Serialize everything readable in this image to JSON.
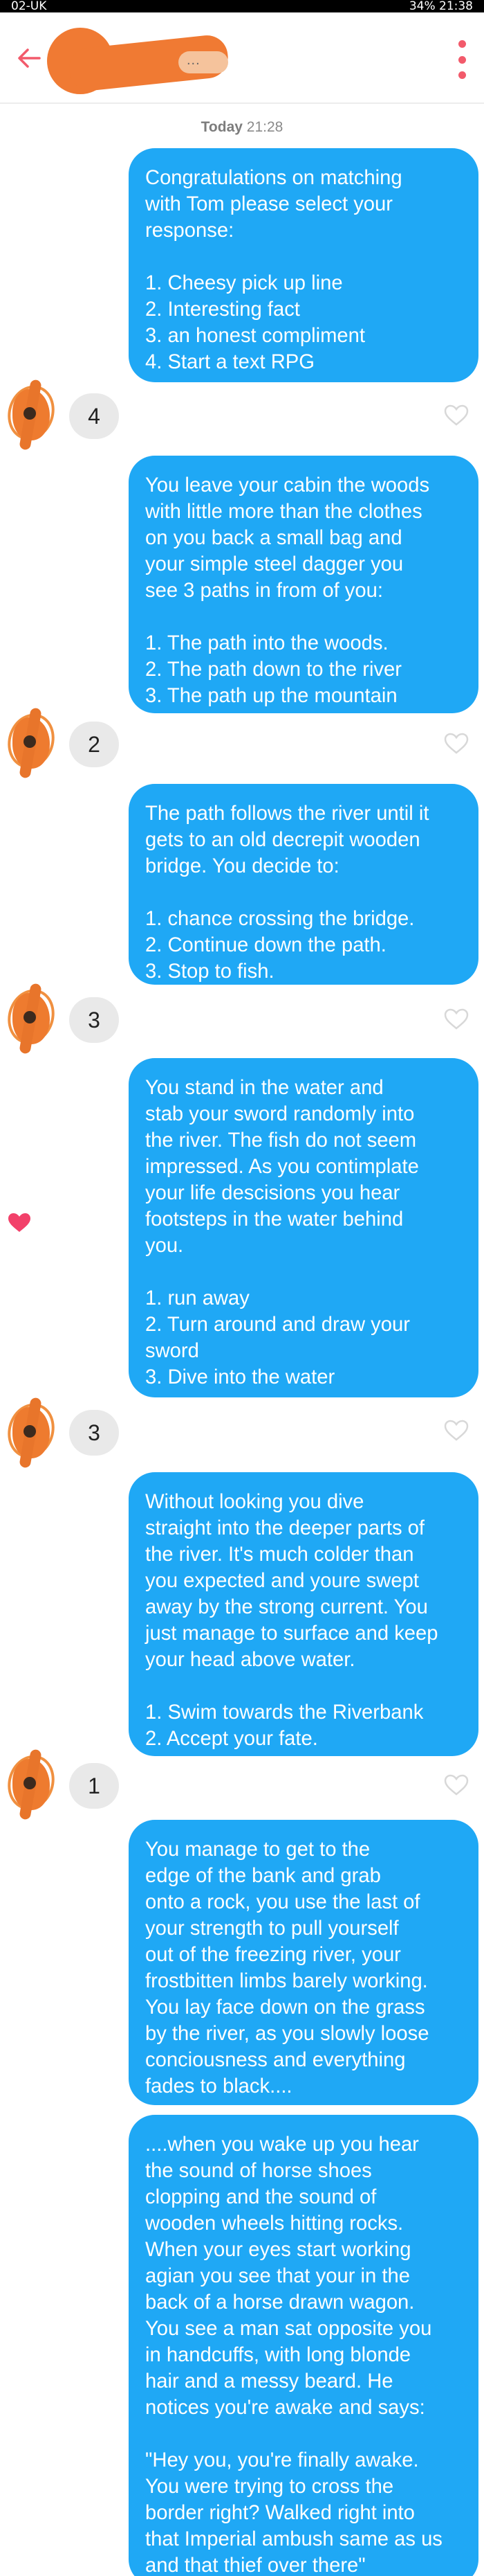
{
  "status_bar": {
    "left": "02-UK",
    "right": "34% 21:38"
  },
  "header": {
    "name_fragment": "..."
  },
  "timestamp": {
    "day": "Today",
    "time": "21:28"
  },
  "colors": {
    "bubble": "#1fa8f5",
    "accent": "#f25a6b",
    "reply_bubble": "#e9e9e9"
  },
  "messages": [
    {
      "text": "Congratulations on matching\nwith Tom please select your\nresponse:\n\n1. Cheesy pick up line\n2. Interesting fact\n3. an honest compliment\n4. Start a text RPG"
    },
    {
      "text": "You leave your cabin the woods\nwith little more than the clothes\non you back a small bag and\nyour simple steel dagger you\nsee 3 paths in from of you:\n\n1. The path into the woods.\n2. The path down to the river\n3. The path up the mountain"
    },
    {
      "text": "The path follows the river until it\ngets to an old decrepit wooden\nbridge. You decide to:\n\n1. chance crossing the bridge.\n2. Continue down the path.\n3. Stop to fish."
    },
    {
      "text": "You stand in the water and\nstab your sword randomly into\nthe river. The fish do not seem\nimpressed. As you contimplate\nyour life descisions you hear\nfootsteps in the water behind\nyou.\n\n1. run away\n2. Turn around and draw your\nsword\n3. Dive into the water"
    },
    {
      "text": "Without looking you dive\nstraight into the deeper parts of\nthe river. It's much colder than\nyou expected and youre swept\naway by the strong current. You\njust manage to surface and keep\nyour head above water.\n\n1. Swim towards the Riverbank\n2. Accept your fate."
    },
    {
      "text": "You manage to get to the\nedge of the bank and grab\nonto a rock, you use the last of\nyour strength to pull yourself\nout of the freezing river, your\nfrostbitten limbs barely working.\nYou lay face down on the grass\nby the river, as you slowly loose\nconciousness and everything\nfades to black...."
    },
    {
      "text": "....when you wake up you hear\nthe sound of horse shoes\nclopping and the sound of\nwooden wheels hitting rocks.\nWhen your eyes start working\nagian you see that your in the\nback of a horse drawn wagon.\nYou see a man sat opposite you\nin handcuffs, with long blonde\nhair and a messy beard. He\nnotices you're awake and says:\n\n\"Hey you, you're finally awake.\nYou were trying to cross the\nborder right? Walked right into\nthat Imperial ambush same as us\nand that thief over there\""
    }
  ],
  "replies": [
    {
      "text": "4"
    },
    {
      "text": "2"
    },
    {
      "text": "3"
    },
    {
      "text": "3"
    },
    {
      "text": "1"
    }
  ],
  "icons": {
    "back": "back-arrow-icon",
    "menu": "kebab-menu-icon",
    "like": "heart-outline-icon",
    "liked": "heart-filled-icon"
  }
}
